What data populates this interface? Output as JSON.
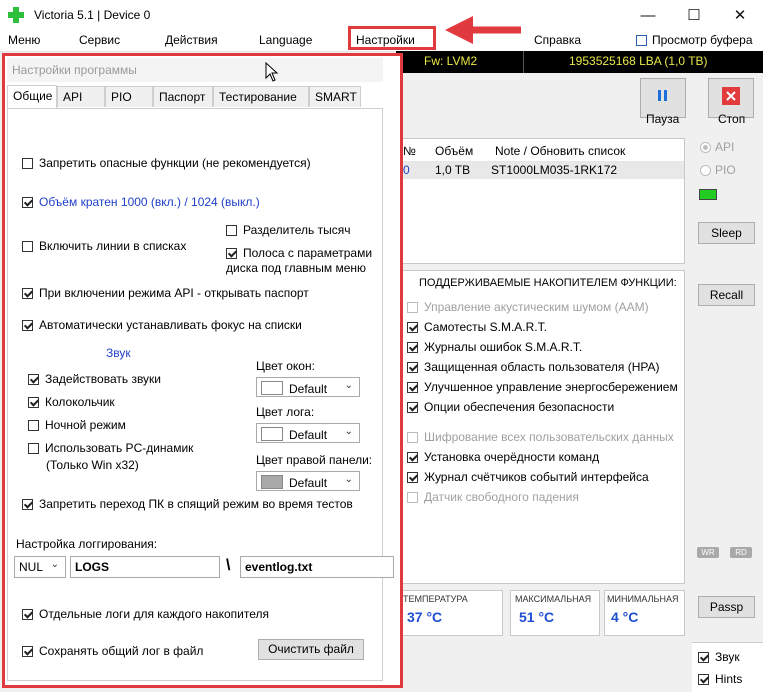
{
  "window": {
    "title": "Victoria 5.1 | Device 0",
    "minimize": "—",
    "maximize": "☐",
    "close": "✕"
  },
  "menu": {
    "items": [
      "Меню",
      "Сервис",
      "Действия",
      "Language",
      "Настройки",
      "Справка"
    ],
    "buffer_view": "Просмотр буфера"
  },
  "infobar": {
    "fw": "Fw: LVM2",
    "lba": "1953525168 LBA (1,0 TB)"
  },
  "toolbar": {
    "pause_label": "Пауза",
    "stop_label": "Стоп"
  },
  "device_table": {
    "headers": [
      "№",
      "Объём",
      "Note / Обновить список"
    ],
    "rows": [
      {
        "num": "0",
        "size": "1,0 TB",
        "note": "ST1000LM035-1RK172"
      }
    ]
  },
  "features": {
    "title": "ПОДДЕРЖИВАЕМЫЕ НАКОПИТЕЛЕМ ФУНКЦИИ:",
    "items": [
      {
        "label": "Управление акустическим шумом (AAM)",
        "checked": false,
        "enabled": false
      },
      {
        "label": "Самотесты S.M.A.R.T.",
        "checked": true,
        "enabled": true
      },
      {
        "label": "Журналы ошибок S.M.A.R.T.",
        "checked": true,
        "enabled": true
      },
      {
        "label": "Защищенная область пользователя (HPA)",
        "checked": true,
        "enabled": true
      },
      {
        "label": "Улучшенное управление энергосбережением",
        "checked": true,
        "enabled": true
      },
      {
        "label": "Опции обеспечения безопасности",
        "checked": true,
        "enabled": true
      },
      {
        "label": "Шифрование всех пользовательских данных",
        "checked": false,
        "enabled": false
      },
      {
        "label": "Установка очерёдности команд",
        "checked": true,
        "enabled": true
      },
      {
        "label": "Журнал счётчиков событий интерфейса",
        "checked": true,
        "enabled": true
      },
      {
        "label": "Датчик свободного падения",
        "checked": false,
        "enabled": false
      }
    ]
  },
  "temperature": {
    "current_label": "ТЕМПЕРАТУРА",
    "current_value": "37 °C",
    "max_label": "МАКСИМАЛЬНАЯ",
    "max_value": "51 °C",
    "min_label": "МИНИМАЛЬНАЯ",
    "min_value": "4 °C"
  },
  "side": {
    "api_label": "API",
    "pio_label": "PIO",
    "sleep": "Sleep",
    "recall": "Recall",
    "passp": "Passp",
    "wr": "WR",
    "rd": "RD",
    "sound_label": "Звук",
    "hints_label": "Hints"
  },
  "dialog": {
    "title": "Настройки программы",
    "tabs": [
      "Общие",
      "API",
      "PIO",
      "Паспорт",
      "Тестирование",
      "SMART"
    ],
    "opt_dangerous": "Запретить опасные функции (не рекомендуется)",
    "opt_volume": "Объём кратен 1000 (вкл.) / 1024 (выкл.)",
    "opt_thousands": "Разделитель тысяч",
    "opt_lines": "Включить линии в списках",
    "opt_diskbar": "Полоса с параметрами диска под главным меню",
    "opt_passport": "При включении режима API - открывать паспорт",
    "opt_focus": "Автоматически устанавливать фокус на списки",
    "sound_header": "Звук",
    "opt_sounds": "Задействовать звуки",
    "opt_bell": "Колокольчик",
    "opt_night": "Ночной режим",
    "opt_pcspeaker": "Использовать PC-динамик",
    "opt_pcspeaker_note": "(Только Win x32)",
    "window_color_label": "Цвет окон:",
    "window_color_value": "Default",
    "log_color_label": "Цвет лога:",
    "log_color_value": "Default",
    "panel_color_label": "Цвет правой панели:",
    "panel_color_value": "Default",
    "opt_nosleep": "Запретить переход ПК в спящий режим во время тестов",
    "logging_label": "Настройка логгирования:",
    "log_mode": "NUL",
    "log_folder": "LOGS",
    "log_sep": "\\",
    "log_file": "eventlog.txt",
    "opt_separate_logs": "Отдельные логи для каждого накопителя",
    "opt_save_common": "Сохранять общий лог в файл",
    "clear_file": "Очистить файл"
  },
  "colors": {
    "accent_red": "#e0393e",
    "status_green": "#22cc22",
    "temp_blue": "#1f4fd1"
  }
}
